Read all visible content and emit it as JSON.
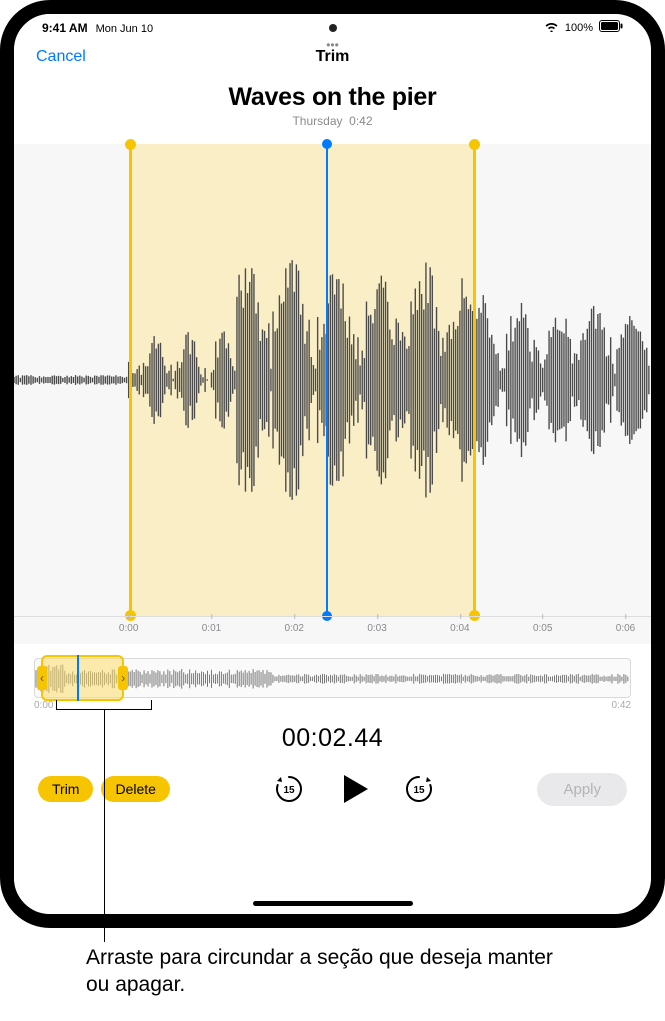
{
  "status": {
    "time": "9:41 AM",
    "date": "Mon Jun 10",
    "battery_pct": "100%"
  },
  "nav": {
    "cancel": "Cancel",
    "title": "Trim"
  },
  "recording": {
    "title": "Waves on the pier",
    "day": "Thursday",
    "duration": "0:42"
  },
  "ruler": {
    "ticks": [
      "0:00",
      "0:01",
      "0:02",
      "0:03",
      "0:04",
      "0:05",
      "0:06"
    ]
  },
  "overview": {
    "start": "0:00",
    "end": "0:42"
  },
  "playback": {
    "time": "00:02.44"
  },
  "actions": {
    "trim": "Trim",
    "delete": "Delete",
    "apply": "Apply",
    "skip_back": "15",
    "skip_fwd": "15"
  },
  "caption": "Arraste para circundar a seção que deseja manter ou apagar.",
  "icons": {
    "more": "•••"
  }
}
